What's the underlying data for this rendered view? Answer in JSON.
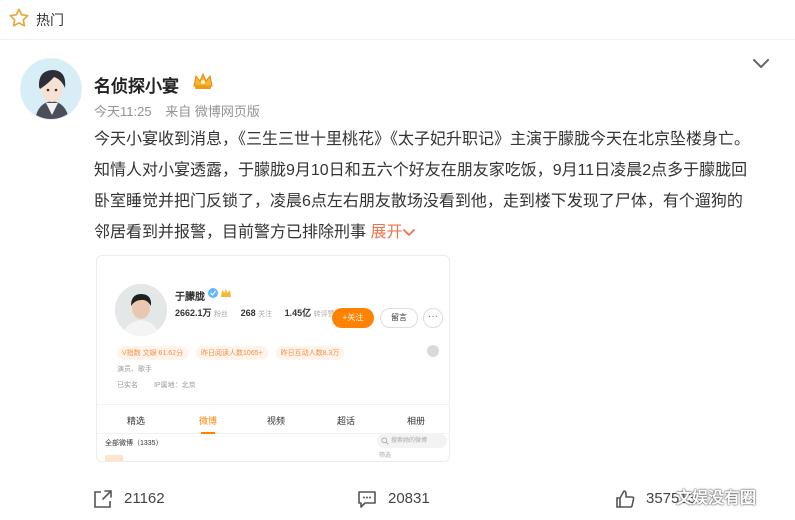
{
  "topbar": {
    "title": "热门",
    "icon": "hot-star-icon"
  },
  "post": {
    "author": "名侦探小宴",
    "time": "今天11:25",
    "source": "来自 微博网页版",
    "text": "今天小宴收到消息，《三生三世十里桃花》《太子妃升职记》主演于朦胧今天在北京坠楼身亡。知情人对小宴透露，于朦胧9月10日和五六个好友在朋友家吃饭，9月11日凌晨2点多于朦胧回卧室睡觉并把门反锁了，凌晨6点左右朋友散场没看到他，走到楼下发现了尸体，有个遛狗的邻居看到并报警，目前警方已排除刑事",
    "expand": "展开"
  },
  "screenshot": {
    "name": "于朦胧",
    "followers": "2662.1万",
    "followers_label": "粉丝",
    "following": "268",
    "following_label": "关注",
    "likes": "1.45亿",
    "likes_label": "转评赞",
    "follow_button": "+关注",
    "message_button": "留言",
    "more_button": "···",
    "tags": [
      "V指数 文娱 61.62分",
      "昨日阅读人数1065+",
      "昨日互动人数8.3万"
    ],
    "info_line1": "演员、歌手",
    "info_line2a": "已实名",
    "info_line2b": "IP属地：北京",
    "tabs": [
      "精选",
      "微博",
      "视频",
      "超话",
      "相册"
    ],
    "active_tab": "微博",
    "all_posts": "全部微博（1335）",
    "search_placeholder": "搜索她的微博",
    "filter": "筛选"
  },
  "actions": {
    "share_count": "21162",
    "comment_count": "20831",
    "like_count": "357513"
  },
  "watermark": "文娱没有圈",
  "colors": {
    "accent": "#eb7350",
    "orange": "#ff8200",
    "icon": "#555555"
  }
}
